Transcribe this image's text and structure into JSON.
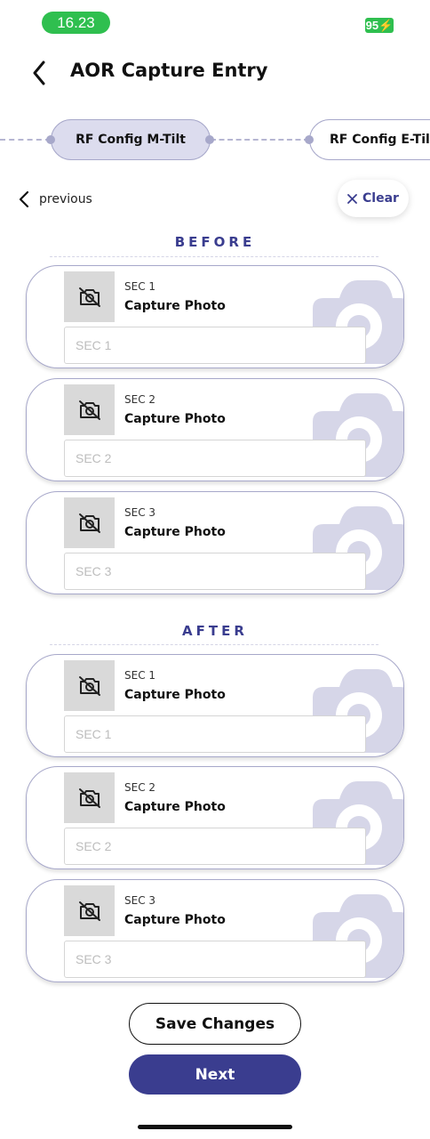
{
  "status_bar": {
    "time": "16.23",
    "battery": "95⚡"
  },
  "header": {
    "title": "AOR Capture Entry"
  },
  "stepper": {
    "active_step": "RF Config M-Tilt",
    "next_step": "RF Config E-Tilt"
  },
  "nav": {
    "previous_label": "previous",
    "clear_label": "Clear"
  },
  "before": {
    "title": "BEFORE",
    "cards": [
      {
        "sector": "SEC 1",
        "action": "Capture Photo",
        "placeholder": "SEC 1"
      },
      {
        "sector": "SEC 2",
        "action": "Capture Photo",
        "placeholder": "SEC 2"
      },
      {
        "sector": "SEC 3",
        "action": "Capture Photo",
        "placeholder": "SEC 3"
      }
    ]
  },
  "after": {
    "title": "AFTER",
    "cards": [
      {
        "sector": "SEC 1",
        "action": "Capture Photo",
        "placeholder": "SEC 1"
      },
      {
        "sector": "SEC 2",
        "action": "Capture Photo",
        "placeholder": "SEC 2"
      },
      {
        "sector": "SEC 3",
        "action": "Capture Photo",
        "placeholder": "SEC 3"
      }
    ]
  },
  "footer": {
    "save_label": "Save Changes",
    "next_label": "Next"
  },
  "colors": {
    "accent": "#3a3d8f",
    "pill_active": "#dcdcee",
    "border": "#a7a8ca",
    "status_green": "#2fbf4f",
    "camera_decor": "#d6d6e8"
  }
}
